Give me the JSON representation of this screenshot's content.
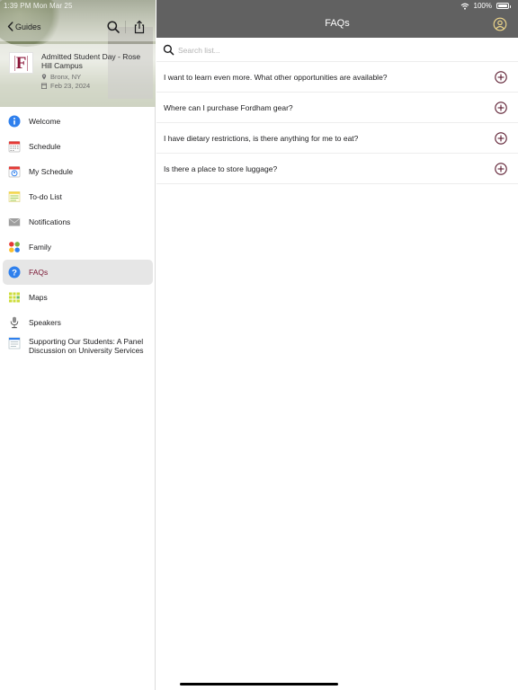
{
  "status_bar": {
    "time": "1:39 PM   Mon Mar 25",
    "battery": "100%",
    "battery_level": 1.0,
    "icons": [
      "wifi-icon",
      "battery-icon"
    ]
  },
  "sidebar": {
    "back_label": "Guides",
    "event": {
      "title": "Admitted Student Day - Rose Hill Campus",
      "location": "Bronx, NY",
      "date": "Feb 23, 2024",
      "logo_letter": "F"
    },
    "items": [
      {
        "label": "Welcome",
        "icon": "info-icon"
      },
      {
        "label": "Schedule",
        "icon": "calendar-icon"
      },
      {
        "label": "My Schedule",
        "icon": "my-schedule-icon"
      },
      {
        "label": "To-do List",
        "icon": "todo-list-icon"
      },
      {
        "label": "Notifications",
        "icon": "envelope-icon"
      },
      {
        "label": "Family",
        "icon": "family-icon"
      },
      {
        "label": "FAQs",
        "icon": "question-icon",
        "selected": true
      },
      {
        "label": "Maps",
        "icon": "map-icon"
      },
      {
        "label": "Speakers",
        "icon": "speaker-icon"
      },
      {
        "label": "Supporting Our Students: A Panel Discussion on University Services",
        "icon": "document-icon"
      }
    ]
  },
  "main": {
    "title": "FAQs",
    "search": {
      "placeholder": "Search list...",
      "value": ""
    },
    "faqs": [
      {
        "question": "I want to learn even more. What other opportunities are available?"
      },
      {
        "question": "Where can I purchase Fordham gear?"
      },
      {
        "question": "I have dietary restrictions, is there anything for me to eat?"
      },
      {
        "question": "Is there a place to store luggage?"
      }
    ]
  },
  "colors": {
    "brand": "#8a1538",
    "topbar": "#616161",
    "info_blue": "#2f80ed",
    "selected_bg": "#e6e6e6"
  }
}
